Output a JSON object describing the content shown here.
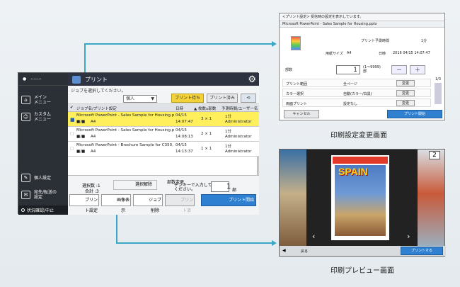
{
  "main": {
    "side": {
      "user": "-------",
      "items": [
        {
          "label": "メイン\nメニュー",
          "icon": "home-icon"
        },
        {
          "label": "カスタム\nメニュー",
          "icon": "users-icon"
        }
      ],
      "low_items": [
        {
          "label": "個人設定",
          "icon": "personal-icon"
        },
        {
          "label": "宛先/転送の\n設定",
          "icon": "address-icon"
        }
      ],
      "status": "状況確認/中止"
    },
    "title": "プリント",
    "instruction": "ジョブを選択してください。",
    "filter_select": "個人",
    "btn_waiting": "プリント待ち",
    "btn_printed": "プリント済み",
    "btn_refresh": "⟲",
    "table": {
      "headers": [
        "ジョブ名/プリント設定",
        "日時",
        "▲ 枚数x部数",
        "予測時間/ユーザー名"
      ],
      "rows": [
        {
          "name": "Microsoft PowerPoint - Sales Sample for Housing.pptx",
          "settings": "A4",
          "date": "04/15",
          "time": "14:07:47",
          "qty": "3 ×  1",
          "est": "1分",
          "user": "Administrator",
          "selected": true
        },
        {
          "name": "Microsoft PowerPoint - Sales Sample for Housing.pptx",
          "settings": "A4",
          "date": "04/15",
          "time": "14:08:13",
          "qty": "2 ×  1",
          "est": "1分",
          "user": "Administrator",
          "selected": false
        },
        {
          "name": "Microsoft PowerPoint - Brochure Sample for C350, C...",
          "settings": "A4",
          "date": "04/15",
          "time": "14:13:37",
          "qty": "1 ×  1",
          "est": "1分",
          "user": "Administrator",
          "selected": false
        }
      ]
    },
    "sel_count": "選択数 :1",
    "total": "合計 :3",
    "deselect": "選択解除",
    "copies_change": "部数変更",
    "copies_hint": "テンキーで入力して\nください。",
    "copies_value": "1",
    "copies_unit": "部",
    "btn_print_settings": "プリント設定",
    "btn_preview": "画像表示",
    "btn_delete": "ジョブ削除",
    "btn_print_done": "プリント済",
    "btn_start": "プリント開始"
  },
  "settings": {
    "header": "<プリント設定> 受信時の設定を表示しています。",
    "doc": "Microsoft PowerPoint - Sales Sample for Housing.pptx",
    "est_label": "プリント予測時間",
    "est_value": "1分",
    "paper_label": "用紙サイズ",
    "paper_value": "A4",
    "date_label": "日時",
    "date_value": "2016 04/15 14:07:47",
    "copies_label": "部数",
    "copies_value": "1",
    "copies_range": "(1～9999)\n部",
    "minus": "－",
    "plus": "＋",
    "rows": [
      {
        "label": "プリント範囲",
        "value": "全ページ",
        "btn": "変更"
      },
      {
        "label": "カラー選択",
        "value": "自動(カラー/白黒)",
        "btn": "変更"
      },
      {
        "label": "両面プリント",
        "value": "設定なし",
        "btn": "変更"
      }
    ],
    "page": "1/3",
    "cancel": "キャンセル",
    "start": "プリント開始"
  },
  "caption_settings": "印刷設定変更画面",
  "preview": {
    "cover_title": "SPAIN",
    "page_badge": "2",
    "back": "戻る",
    "print": "プリントする"
  },
  "caption_preview": "印刷プレビュー画面",
  "colors": {
    "accent_blue": "#2f80d0",
    "accent_yellow": "#f3d23a",
    "connector": "#3aa7c4"
  }
}
